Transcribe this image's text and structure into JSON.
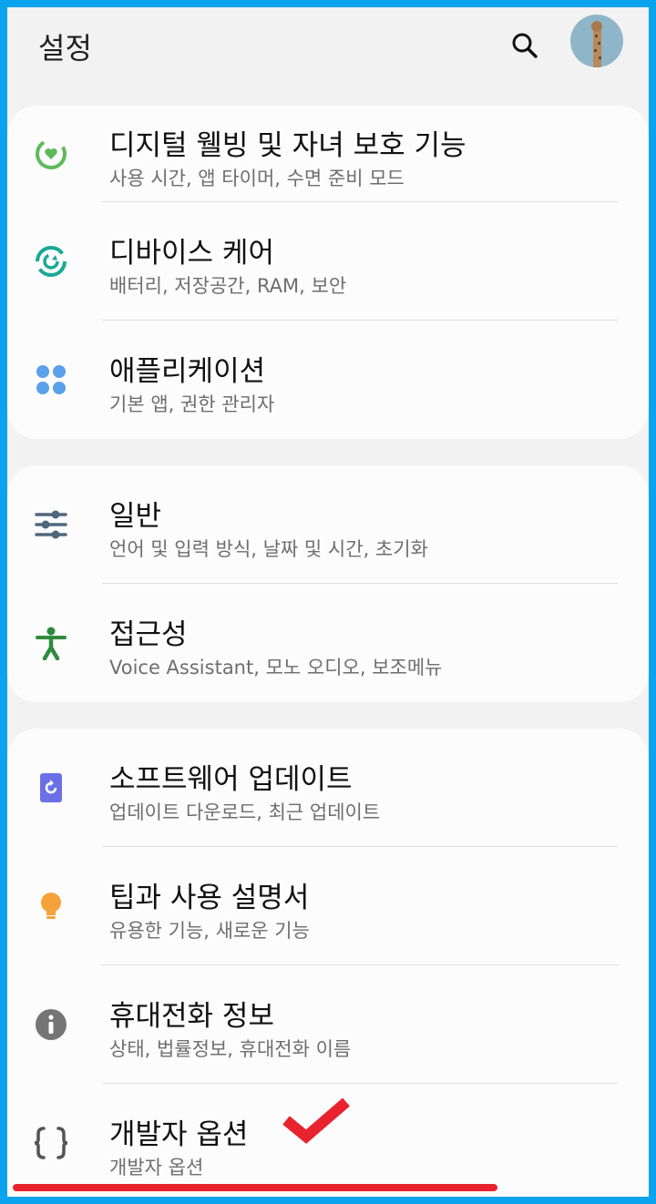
{
  "header": {
    "title": "설정",
    "search_icon": "search-icon",
    "avatar": "profile-avatar"
  },
  "groups": [
    {
      "items": [
        {
          "title": "디지털 웰빙 및 자녀 보호 기능",
          "subtitle": "사용 시간, 앱 타이머, 수면 준비 모드",
          "icon": "digital-wellbeing-icon",
          "color": "#5fba5a"
        },
        {
          "title": "디바이스 케어",
          "subtitle": "배터리, 저장공간, RAM, 보안",
          "icon": "device-care-icon",
          "color": "#1aa896"
        },
        {
          "title": "애플리케이션",
          "subtitle": "기본 앱, 권한 관리자",
          "icon": "apps-icon",
          "color": "#5aa0ea"
        }
      ]
    },
    {
      "items": [
        {
          "title": "일반",
          "subtitle": "언어 및 입력 방식, 날짜 및 시간, 초기화",
          "icon": "general-sliders-icon",
          "color": "#50687c"
        },
        {
          "title": "접근성",
          "subtitle": "Voice Assistant, 모노 오디오, 보조메뉴",
          "icon": "accessibility-icon",
          "color": "#2f8a3e"
        }
      ]
    },
    {
      "items": [
        {
          "title": "소프트웨어 업데이트",
          "subtitle": "업데이트 다운로드, 최근 업데이트",
          "icon": "software-update-icon",
          "color": "#6b70e6"
        },
        {
          "title": "팁과 사용 설명서",
          "subtitle": "유용한 기능, 새로운 기능",
          "icon": "lightbulb-icon",
          "color": "#f6a23b"
        },
        {
          "title": "휴대전화 정보",
          "subtitle": "상태, 법률정보, 휴대전화 이름",
          "icon": "info-icon",
          "color": "#757575"
        },
        {
          "title": "개발자 옵션",
          "subtitle": "개발자 옵션",
          "icon": "developer-braces-icon",
          "color": "#555555"
        }
      ]
    }
  ],
  "annotation_color": "#e8232e"
}
